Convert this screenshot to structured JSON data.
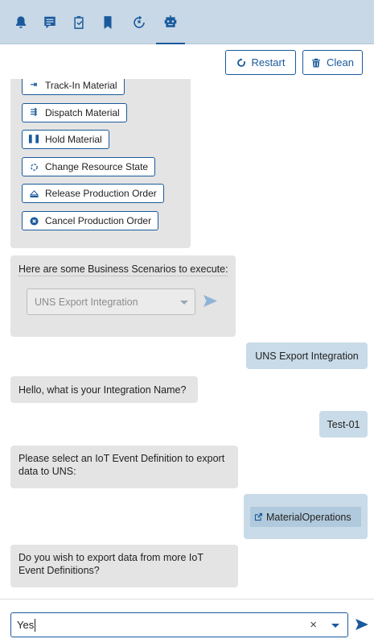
{
  "tabs": [
    {
      "icon": "bell-icon"
    },
    {
      "icon": "message-icon"
    },
    {
      "icon": "clipboard-check-icon"
    },
    {
      "icon": "bookmark-icon"
    },
    {
      "icon": "integration-icon"
    },
    {
      "icon": "robot-icon",
      "active": true
    }
  ],
  "toolbar": {
    "restart_label": "Restart",
    "clean_label": "Clean"
  },
  "chat": {
    "actions": [
      {
        "label": "Track-In Material",
        "icon": "track-in-icon"
      },
      {
        "label": "Dispatch Material",
        "icon": "dispatch-icon"
      },
      {
        "label": "Hold Material",
        "icon": "pause-icon"
      },
      {
        "label": "Change Resource State",
        "icon": "refresh-icon"
      },
      {
        "label": "Release Production Order",
        "icon": "eject-icon"
      },
      {
        "label": "Cancel Production Order",
        "icon": "cancel-circle-icon"
      }
    ],
    "scenarios_prompt": "Here are some Business Scenarios to execute:",
    "scenario_select_value": "UNS Export Integration",
    "user_msg_1": "UNS Export Integration",
    "bot_msg_2": "Hello, what is your Integration Name?",
    "user_msg_2": "Test-01",
    "bot_msg_3": "Please select an IoT Event Definition to export data to UNS:",
    "user_msg_3": "MaterialOperations",
    "bot_msg_4": "Do you wish to export data from more IoT Event Definitions?"
  },
  "input": {
    "value": "Yes",
    "clear_label": "×"
  },
  "colors": {
    "accent": "#1a5a9c",
    "topbar": "#c8d8e6",
    "bot_bubble": "#e4e4e4",
    "user_bubble": "#c9dbe8"
  }
}
